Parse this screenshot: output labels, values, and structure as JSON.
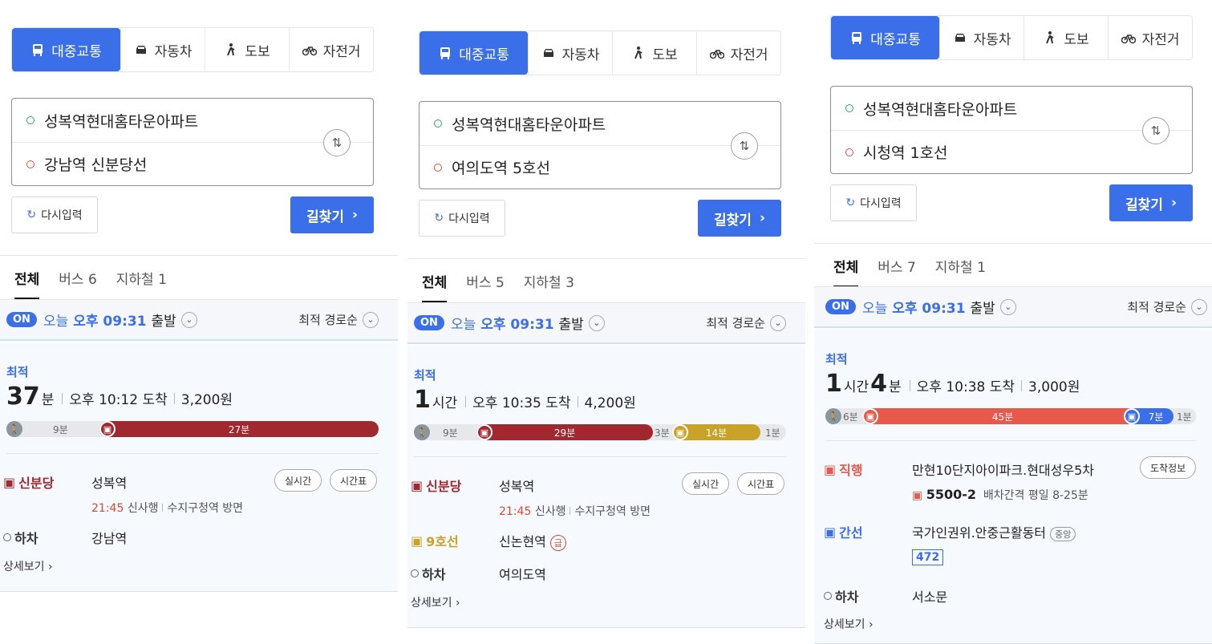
{
  "modes": {
    "transit": "대중교통",
    "car": "자동차",
    "walk": "도보",
    "bike": "자전거"
  },
  "buttons": {
    "reset": "다시입력",
    "search": "길찾기"
  },
  "common": {
    "all_tab": "전체",
    "on_badge": "ON",
    "today": "오늘",
    "depart_time": "오후 09:31",
    "depart_label": "출발",
    "sort": "최적 경로순",
    "best": "최적",
    "detail": "상세보기",
    "hour_unit": "시간",
    "min_unit": "분",
    "alight": "하차",
    "realtime": "실시간",
    "timetable": "시간표",
    "arrival_info": "도착정보"
  },
  "colors": {
    "accent": "#3b6fe9",
    "sinbundang": "#a1282e",
    "line9": "#c9a227",
    "bus_express": "#e8594b",
    "bus_trunk": "#3b6fe9"
  },
  "panels": [
    {
      "origin": "성복역현대홈타운아파트",
      "destination": "강남역 신분당선",
      "tabs": {
        "bus": "버스 6",
        "subway": "지하철 1"
      },
      "route": {
        "minutes": "37",
        "arrive": "오후 10:12 도착",
        "fare": "3,200원",
        "bar": {
          "walk": "9분",
          "seg1": "27분"
        },
        "steps": [
          {
            "line": "신분당",
            "station": "성복역",
            "sub_time": "21:45",
            "sub_dir": "신사행",
            "sub_dest": "수지구청역 방면"
          },
          {
            "station": "강남역"
          }
        ]
      }
    },
    {
      "origin": "성복역현대홈타운아파트",
      "destination": "여의도역 5호선",
      "tabs": {
        "bus": "버스 5",
        "subway": "지하철 3"
      },
      "route": {
        "hours": "1",
        "arrive": "오후 10:35 도착",
        "fare": "4,200원",
        "bar": {
          "walk": "9분",
          "seg1": "29분",
          "gap": "3분",
          "seg2": "14분",
          "end": "1분"
        },
        "steps": [
          {
            "line": "신분당",
            "station": "성복역",
            "sub_time": "21:45",
            "sub_dir": "신사행",
            "sub_dest": "수지구청역 방면"
          },
          {
            "line": "9호선",
            "station": "신논현역",
            "badge": "급"
          },
          {
            "station": "여의도역"
          }
        ]
      }
    },
    {
      "origin": "성복역현대홈타운아파트",
      "destination": "시청역 1호선",
      "tabs": {
        "bus": "버스 7",
        "subway": "지하철 1"
      },
      "route": {
        "hours": "1",
        "minutes": "4",
        "arrive": "오후 10:38 도착",
        "fare": "3,000원",
        "bar": {
          "walk": "6분",
          "seg1": "45분",
          "seg2": "7분",
          "end": "1분"
        },
        "steps": [
          {
            "line": "직행",
            "station": "만현10단지아이파크.현대성우5차",
            "bus_no": "5500-2",
            "interval": "배차간격 평일 8-25분"
          },
          {
            "line": "간선",
            "station": "국가인권위.안중근활동터",
            "badge": "중앙",
            "bus_no": "472"
          },
          {
            "station": "서소문"
          }
        ]
      }
    }
  ]
}
